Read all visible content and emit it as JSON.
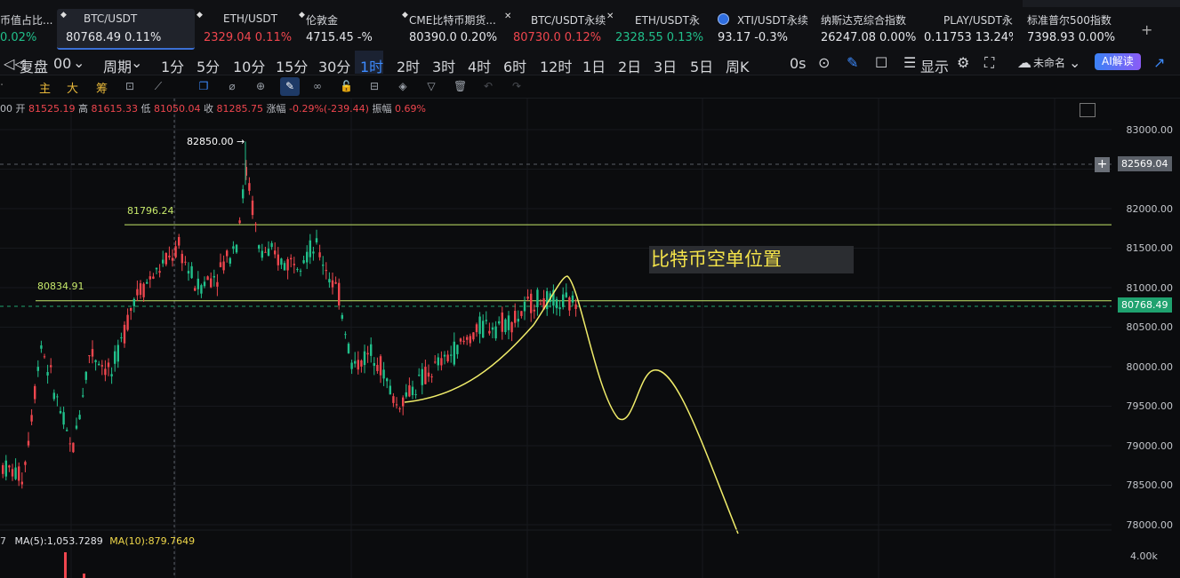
{
  "tickers": [
    {
      "name": "币值占比...",
      "price": "",
      "change": "0.02%",
      "color": "green"
    },
    {
      "name": "BTC/USDT",
      "price": "80768.49",
      "change": "0.11%",
      "color": "white",
      "active": true
    },
    {
      "name": "ETH/USDT",
      "price": "2329.04",
      "change": "0.11%",
      "color": "red"
    },
    {
      "name": "伦敦金",
      "price": "4715.45",
      "change": "-%",
      "color": "white"
    },
    {
      "name": "CME比特币期货...",
      "price": "80390.0",
      "change": "0.20%",
      "color": "white"
    },
    {
      "name": "BTC/USDT永续",
      "price": "80730.0",
      "change": "0.12%",
      "color": "red"
    },
    {
      "name": "ETH/USDT永",
      "price": "2328.55",
      "change": "0.13%",
      "color": "green"
    },
    {
      "name": "XTI/USDT永续",
      "price": "93.17",
      "change": "-0.3%",
      "color": "white"
    },
    {
      "name": "纳斯达克综合指数",
      "price": "26247.08",
      "change": "0.00%",
      "color": "white"
    },
    {
      "name": "PLAY/USDT永",
      "price": "0.11753",
      "change": "13.24%",
      "color": "white"
    },
    {
      "name": "标准普尔500指数",
      "price": "7398.93",
      "change": "0.00%",
      "color": "white"
    }
  ],
  "add_ticker": "+",
  "toolbar1": {
    "replay": "复盘",
    "chart_type": "00",
    "period_menu": "周期",
    "intervals": [
      "1分",
      "5分",
      "10分",
      "15分",
      "30分",
      "1时",
      "2时",
      "3时",
      "4时",
      "6时",
      "12时",
      "1日",
      "2日",
      "3日",
      "5日",
      "周K"
    ],
    "active_interval": "1时",
    "countdown": "0s",
    "display": "显示",
    "layout_name": "未命名",
    "ai_button": "AI解读"
  },
  "toolbar2": {
    "main_label": "主",
    "big_label": "大",
    "chip_label": "筹"
  },
  "ohlc": {
    "open_label": "开",
    "open": "81525.19",
    "high_label": "高",
    "high": "81615.33",
    "low_label": "低",
    "low": "81050.04",
    "close_label": "收",
    "close": "81285.75",
    "change_label": "涨幅",
    "change": "-0.29%(-239.44)",
    "amp_label": "振幅",
    "amp": "0.69%"
  },
  "price_axis": {
    "labels": [
      "83000.00",
      "82000.00",
      "81500.00",
      "81000.00",
      "80500.00",
      "80000.00",
      "79500.00",
      "79000.00",
      "78500.00",
      "78000.00"
    ],
    "hover_price": "82569.04",
    "current_price": "80768.49",
    "volume_label": "4.00k"
  },
  "chart_annotations": {
    "high_marker": "82850.00",
    "level_upper": "81796.24",
    "level_lower": "80834.91",
    "text_box": "比特币空单位置"
  },
  "indicators": {
    "ma5": "MA(5):1,053.7289",
    "ma10": "MA(10):879.7649",
    "ma_prefix": "7"
  },
  "colors": {
    "up": "#21c08b",
    "down": "#f0464e",
    "accent": "#3d8bff",
    "forecast": "#f0ec6a",
    "level": "#c6e86a"
  }
}
